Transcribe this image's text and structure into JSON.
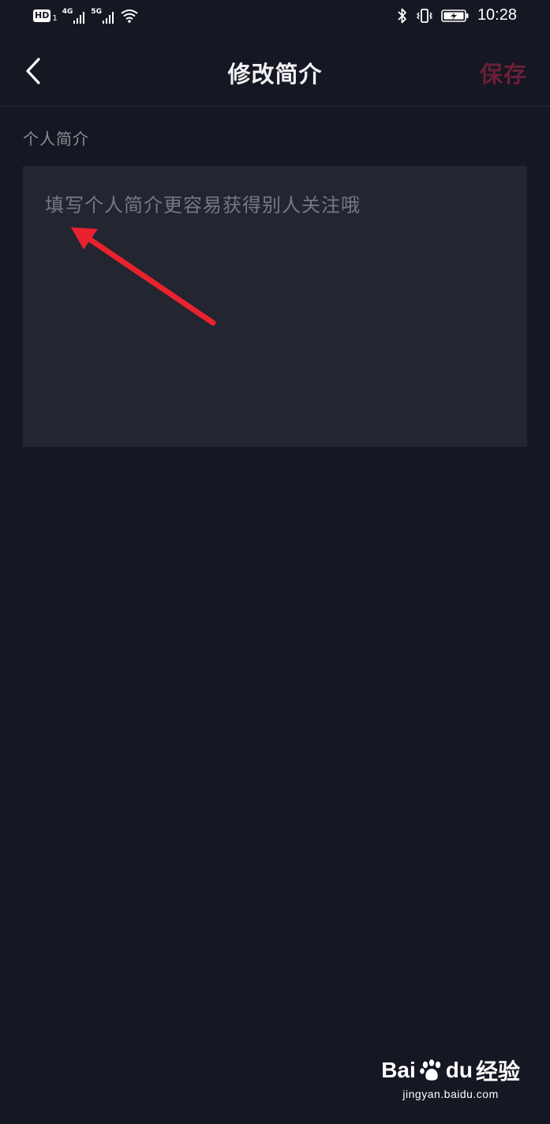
{
  "status_bar": {
    "hd_label": "HD",
    "sim_number": "1",
    "network_1": "4G",
    "network_2": "5G",
    "time": "10:28"
  },
  "nav": {
    "title": "修改简介",
    "save_label": "保存",
    "save_color": "#6a1f38"
  },
  "bio": {
    "section_label": "个人简介",
    "placeholder": "填写个人简介更容易获得别人关注哦",
    "value": ""
  },
  "annotation": {
    "arrow_color": "#e8232e"
  },
  "watermark": {
    "brand_left": "Bai",
    "brand_right": "du",
    "brand_suffix": "经验",
    "domain": "jingyan.baidu.com"
  },
  "colors": {
    "background": "#151722",
    "input_background": "#232530",
    "placeholder": "#767884",
    "label": "#8c8e96"
  }
}
